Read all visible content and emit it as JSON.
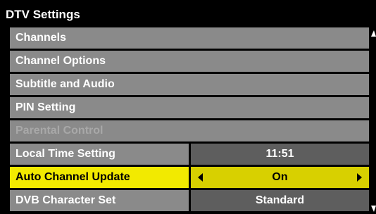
{
  "title": "DTV Settings",
  "menu": {
    "items": [
      {
        "label": "Channels"
      },
      {
        "label": "Channel Options"
      },
      {
        "label": "Subtitle and Audio"
      },
      {
        "label": "PIN Setting"
      },
      {
        "label": "Parental Control",
        "state": "disabled"
      },
      {
        "label": "Local Time Setting",
        "value": "11:51"
      },
      {
        "label": "Auto Channel Update",
        "value": "On",
        "state": "selected"
      },
      {
        "label": "DVB Character Set",
        "value": "Standard"
      }
    ]
  },
  "colors": {
    "background": "#000000",
    "item_bg": "#8a8a8a",
    "value_bg": "#5e5e5e",
    "highlight": "#f2ea00",
    "disabled_text": "#a8a8a8"
  },
  "icons": {
    "left": "arrow-left-icon",
    "right": "arrow-right-icon",
    "scroll_up": "scroll-up-icon",
    "scroll_down": "scroll-down-icon"
  }
}
